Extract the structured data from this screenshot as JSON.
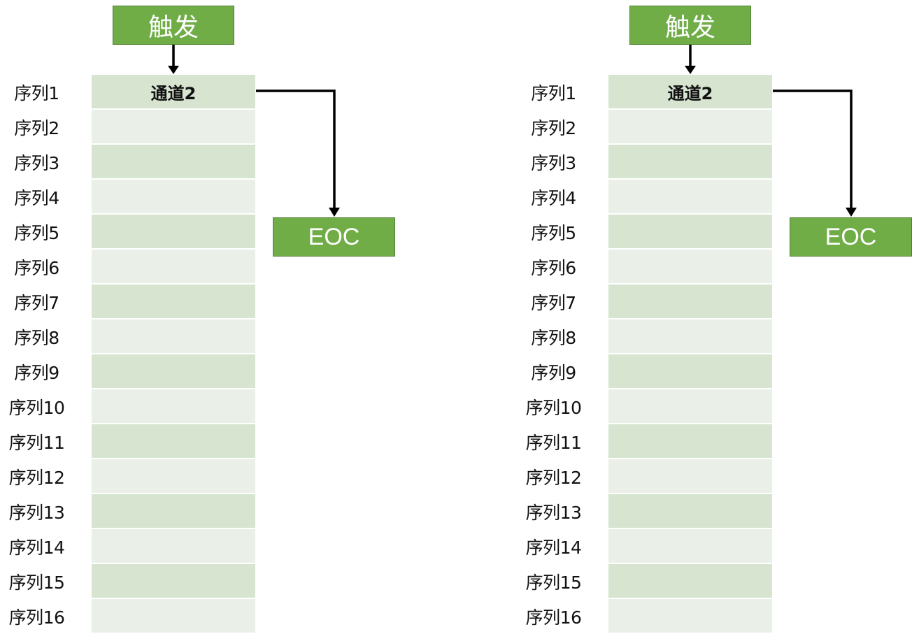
{
  "diagrams": [
    {
      "trigger_label": "触发",
      "channel_label": "通道2",
      "eoc_label": "EOC",
      "sequences": [
        "序列1",
        "序列2",
        "序列3",
        "序列4",
        "序列5",
        "序列6",
        "序列7",
        "序列8",
        "序列9",
        "序列10",
        "序列11",
        "序列12",
        "序列13",
        "序列14",
        "序列15",
        "序列16"
      ]
    },
    {
      "trigger_label": "触发",
      "channel_label": "通道2",
      "eoc_label": "EOC",
      "sequences": [
        "序列1",
        "序列2",
        "序列3",
        "序列4",
        "序列5",
        "序列6",
        "序列7",
        "序列8",
        "序列9",
        "序列10",
        "序列11",
        "序列12",
        "序列13",
        "序列14",
        "序列15",
        "序列16"
      ]
    }
  ],
  "colors": {
    "box_green": "#70ad47",
    "box_border": "#507e32",
    "row_dark": "#d6e4d0",
    "row_light": "#eaf0e7",
    "arrow": "#000000"
  }
}
